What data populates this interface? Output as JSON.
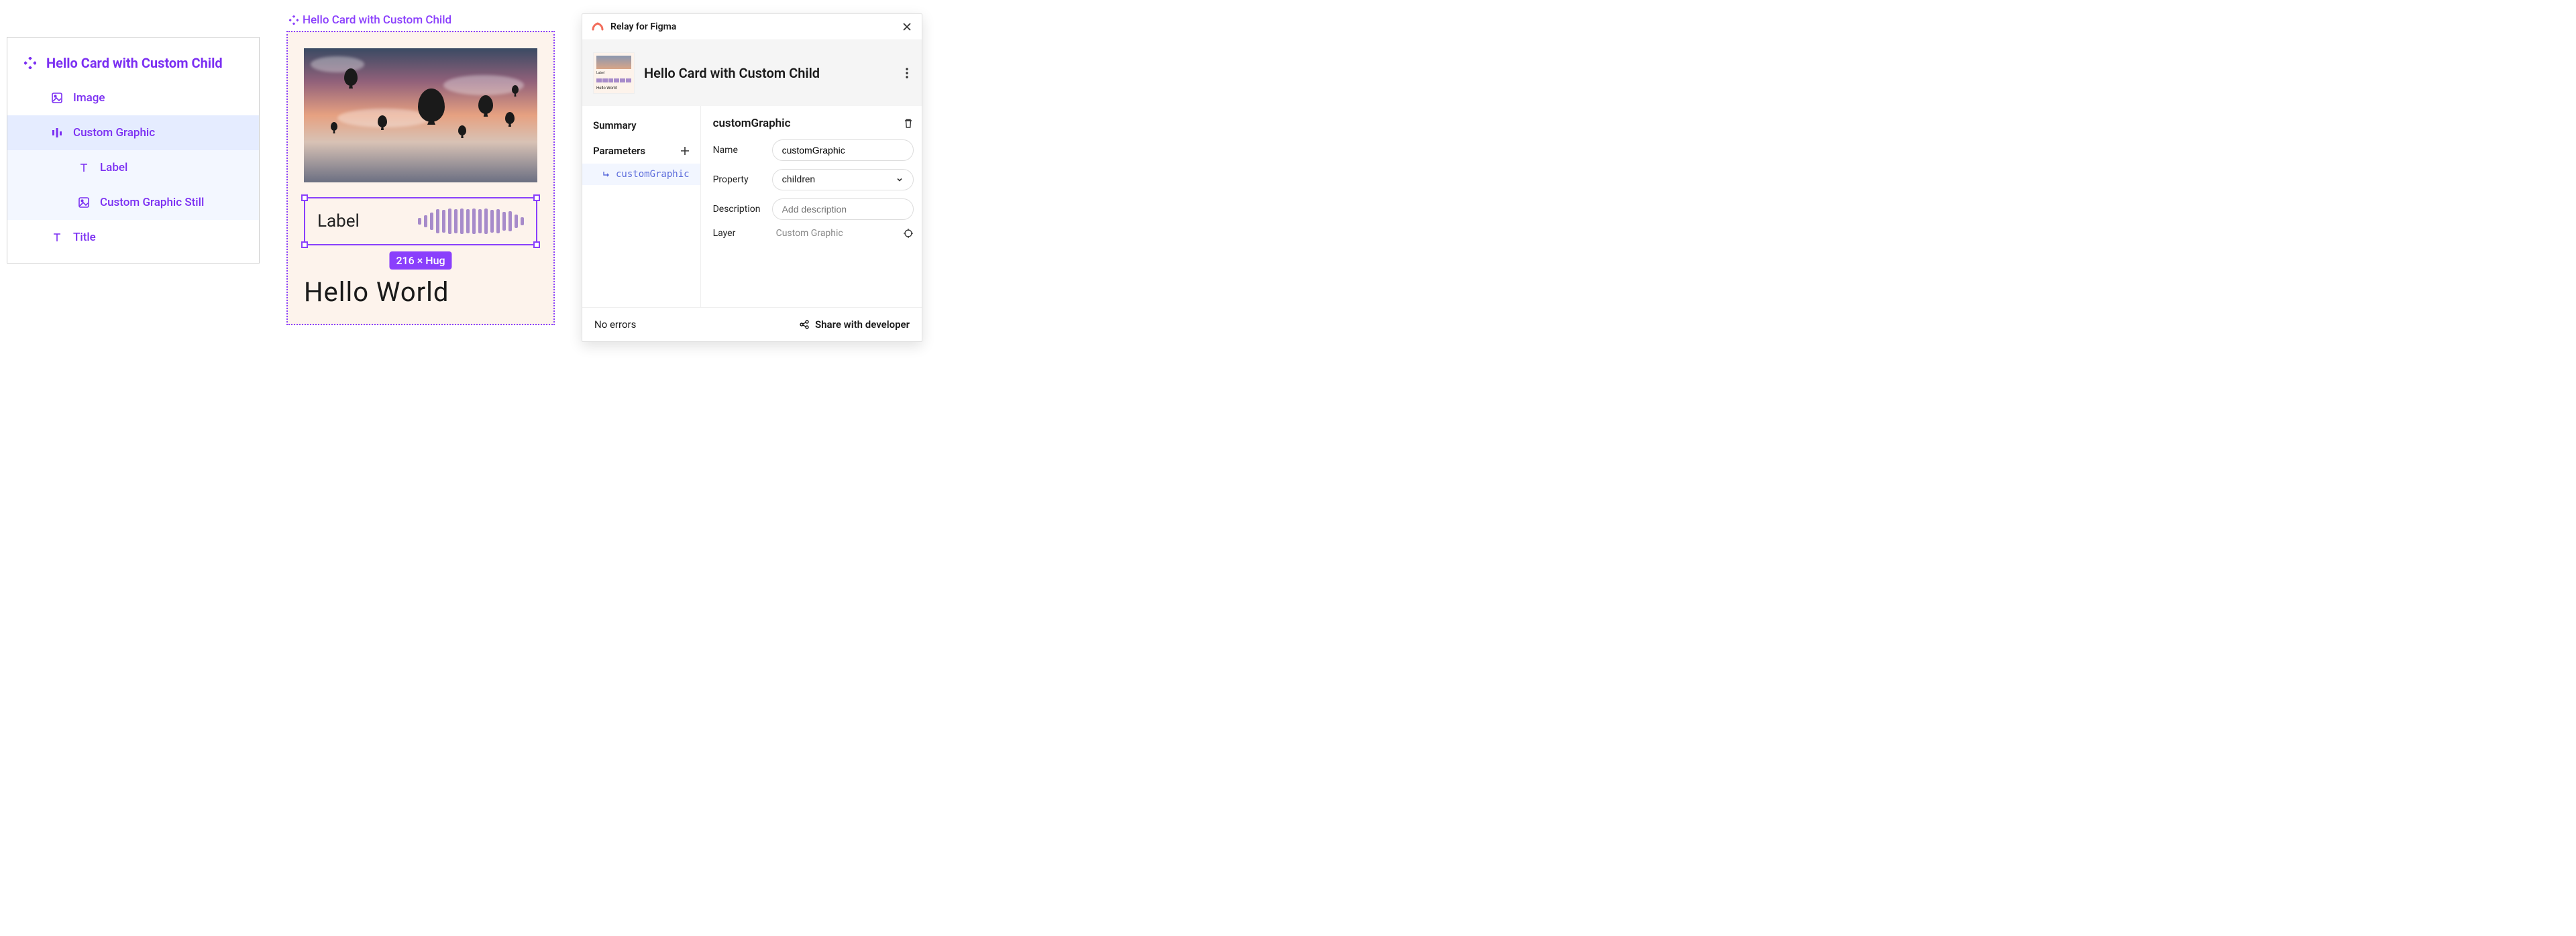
{
  "layers": {
    "header": "Hello Card with Custom Child",
    "items": [
      {
        "label": "Image",
        "icon": "image-icon",
        "indent": 1,
        "selected": false
      },
      {
        "label": "Custom Graphic",
        "icon": "bars-icon",
        "indent": 1,
        "selected": true
      },
      {
        "label": "Label",
        "icon": "text-icon",
        "indent": 2,
        "selected": false,
        "group_open": true
      },
      {
        "label": "Custom Graphic Still",
        "icon": "image-icon",
        "indent": 2,
        "selected": false,
        "group_open": true
      },
      {
        "label": "Title",
        "icon": "text-icon",
        "indent": 1,
        "selected": false
      }
    ]
  },
  "canvas": {
    "frame_label": "Hello Card with Custom Child",
    "custom_graphic": {
      "label": "Label"
    },
    "selection_dims": "216 × Hug",
    "title": "Hello World"
  },
  "plugin": {
    "app_name": "Relay for Figma",
    "component_title": "Hello Card with Custom Child",
    "thumb_text": "Hello World",
    "thumb_label": "Label",
    "left": {
      "summary": "Summary",
      "parameters": "Parameters",
      "param_item": "customGraphic"
    },
    "right": {
      "heading": "customGraphic",
      "name_label": "Name",
      "name_value": "customGraphic",
      "property_label": "Property",
      "property_value": "children",
      "description_label": "Description",
      "description_placeholder": "Add description",
      "layer_label": "Layer",
      "layer_value": "Custom Graphic"
    },
    "footer": {
      "status": "No errors",
      "share": "Share with developer"
    }
  }
}
